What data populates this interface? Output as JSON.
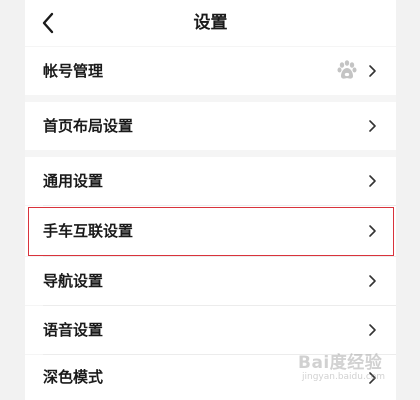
{
  "header": {
    "title": "设置",
    "back_icon": "chevron-left-icon"
  },
  "settings": {
    "account": {
      "label": "帐号管理",
      "trailing_icon": "baidu-paw-icon"
    },
    "home_layout": {
      "label": "首页布局设置"
    },
    "general": {
      "label": "通用设置"
    },
    "phone_car_link": {
      "label": "手车互联设置",
      "highlighted": true
    },
    "navigation": {
      "label": "导航设置"
    },
    "voice": {
      "label": "语音设置"
    },
    "dark_mode": {
      "label": "深色模式"
    }
  },
  "watermark": {
    "brand": "Bai度经验",
    "sub": "jingyan.baidu.com"
  },
  "colors": {
    "highlight_border": "#d9333c",
    "row_background": "#ffffff",
    "page_background": "#f5f5f5"
  }
}
